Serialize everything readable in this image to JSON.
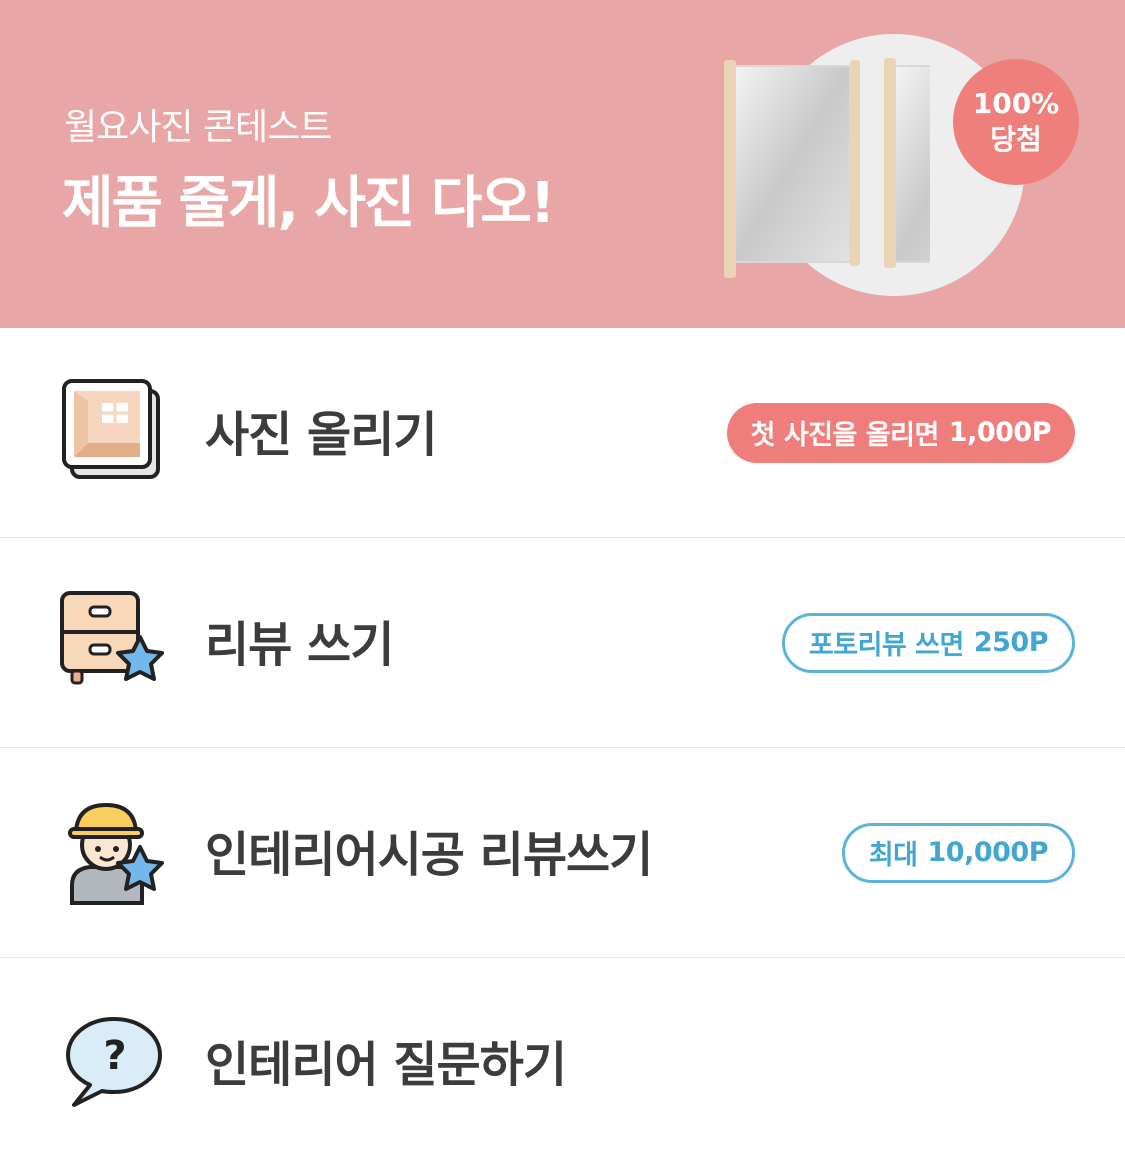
{
  "banner": {
    "subtitle": "월요사진 콘테스트",
    "title": "제품 줄게, 사진 다오!",
    "badge_line1": "100%",
    "badge_line2": "당첨",
    "colors": {
      "background": "#e8a7a6",
      "badge": "#ee7f7d"
    }
  },
  "menu": [
    {
      "label": "사진 올리기",
      "icon": "photo-upload-icon",
      "pill_text": "첫 사진을 올리면",
      "pill_amount": "1,000P",
      "pill_style": "filled-red"
    },
    {
      "label": "리뷰 쓰기",
      "icon": "drawer-star-icon",
      "pill_text": "포토리뷰 쓰면",
      "pill_amount": "250P",
      "pill_style": "outline-blue"
    },
    {
      "label": "인테리어시공 리뷰쓰기",
      "icon": "worker-star-icon",
      "pill_text": "최대",
      "pill_amount": "10,000P",
      "pill_style": "outline-blue"
    },
    {
      "label": "인테리어 질문하기",
      "icon": "question-bubble-icon"
    }
  ],
  "colors": {
    "accent_red": "#ef7d7c",
    "accent_blue": "#42a6d2"
  }
}
